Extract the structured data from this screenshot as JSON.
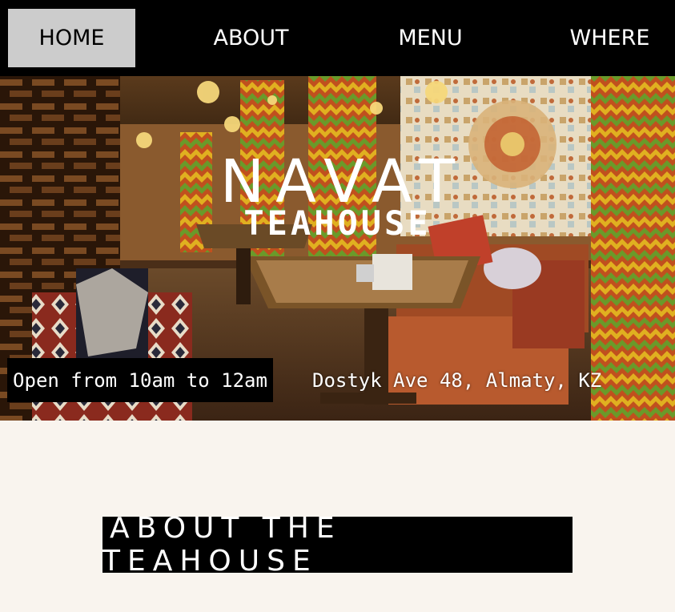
{
  "nav": {
    "items": [
      {
        "label": "HOME",
        "active": true
      },
      {
        "label": "ABOUT",
        "active": false
      },
      {
        "label": "MENU",
        "active": false
      },
      {
        "label": "WHERE",
        "active": false
      }
    ]
  },
  "hero": {
    "title": "NAVAT",
    "subtitle": "TEAHOUSE",
    "hours": "Open from 10am to 12am",
    "address": "Dostyk Ave 48, Almaty, KZ"
  },
  "about": {
    "heading": "ABOUT THE TEAHOUSE"
  },
  "colors": {
    "nav_bg": "#000000",
    "nav_active_bg": "#cccccc",
    "page_bg": "#f9f4ee",
    "text_light": "#ffffff"
  }
}
